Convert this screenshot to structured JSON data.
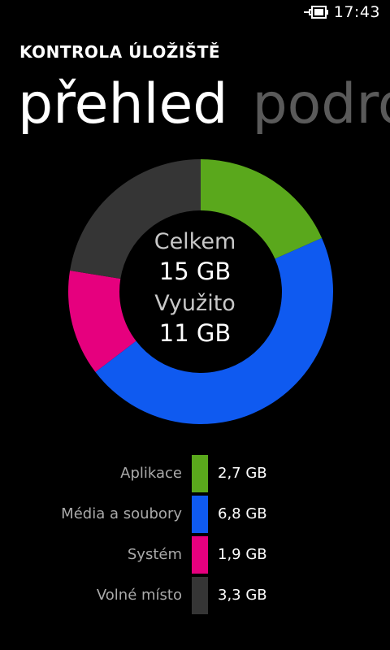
{
  "status": {
    "time": "17:43",
    "battery_icon": "battery-charging-icon"
  },
  "header": {
    "app_title": "KONTROLA ÚLOŽIŠTĚ",
    "pivot": [
      {
        "label": "přehled",
        "active": true
      },
      {
        "label": "podrobnosti",
        "active": false
      }
    ]
  },
  "summary": {
    "total_label": "Celkem",
    "total_value": "15 GB",
    "used_label": "Využito",
    "used_value": "11 GB"
  },
  "chart_data": {
    "type": "pie",
    "categories": [
      "Aplikace",
      "Média a soubory",
      "Systém",
      "Volné místo"
    ],
    "values": [
      2.7,
      6.8,
      1.9,
      3.3
    ],
    "colors": [
      "#5aa81c",
      "#0f5af0",
      "#e6007e",
      "#353535"
    ],
    "labels": [
      "2,7 GB",
      "6,8 GB",
      "1,9 GB",
      "3,3 GB"
    ]
  }
}
